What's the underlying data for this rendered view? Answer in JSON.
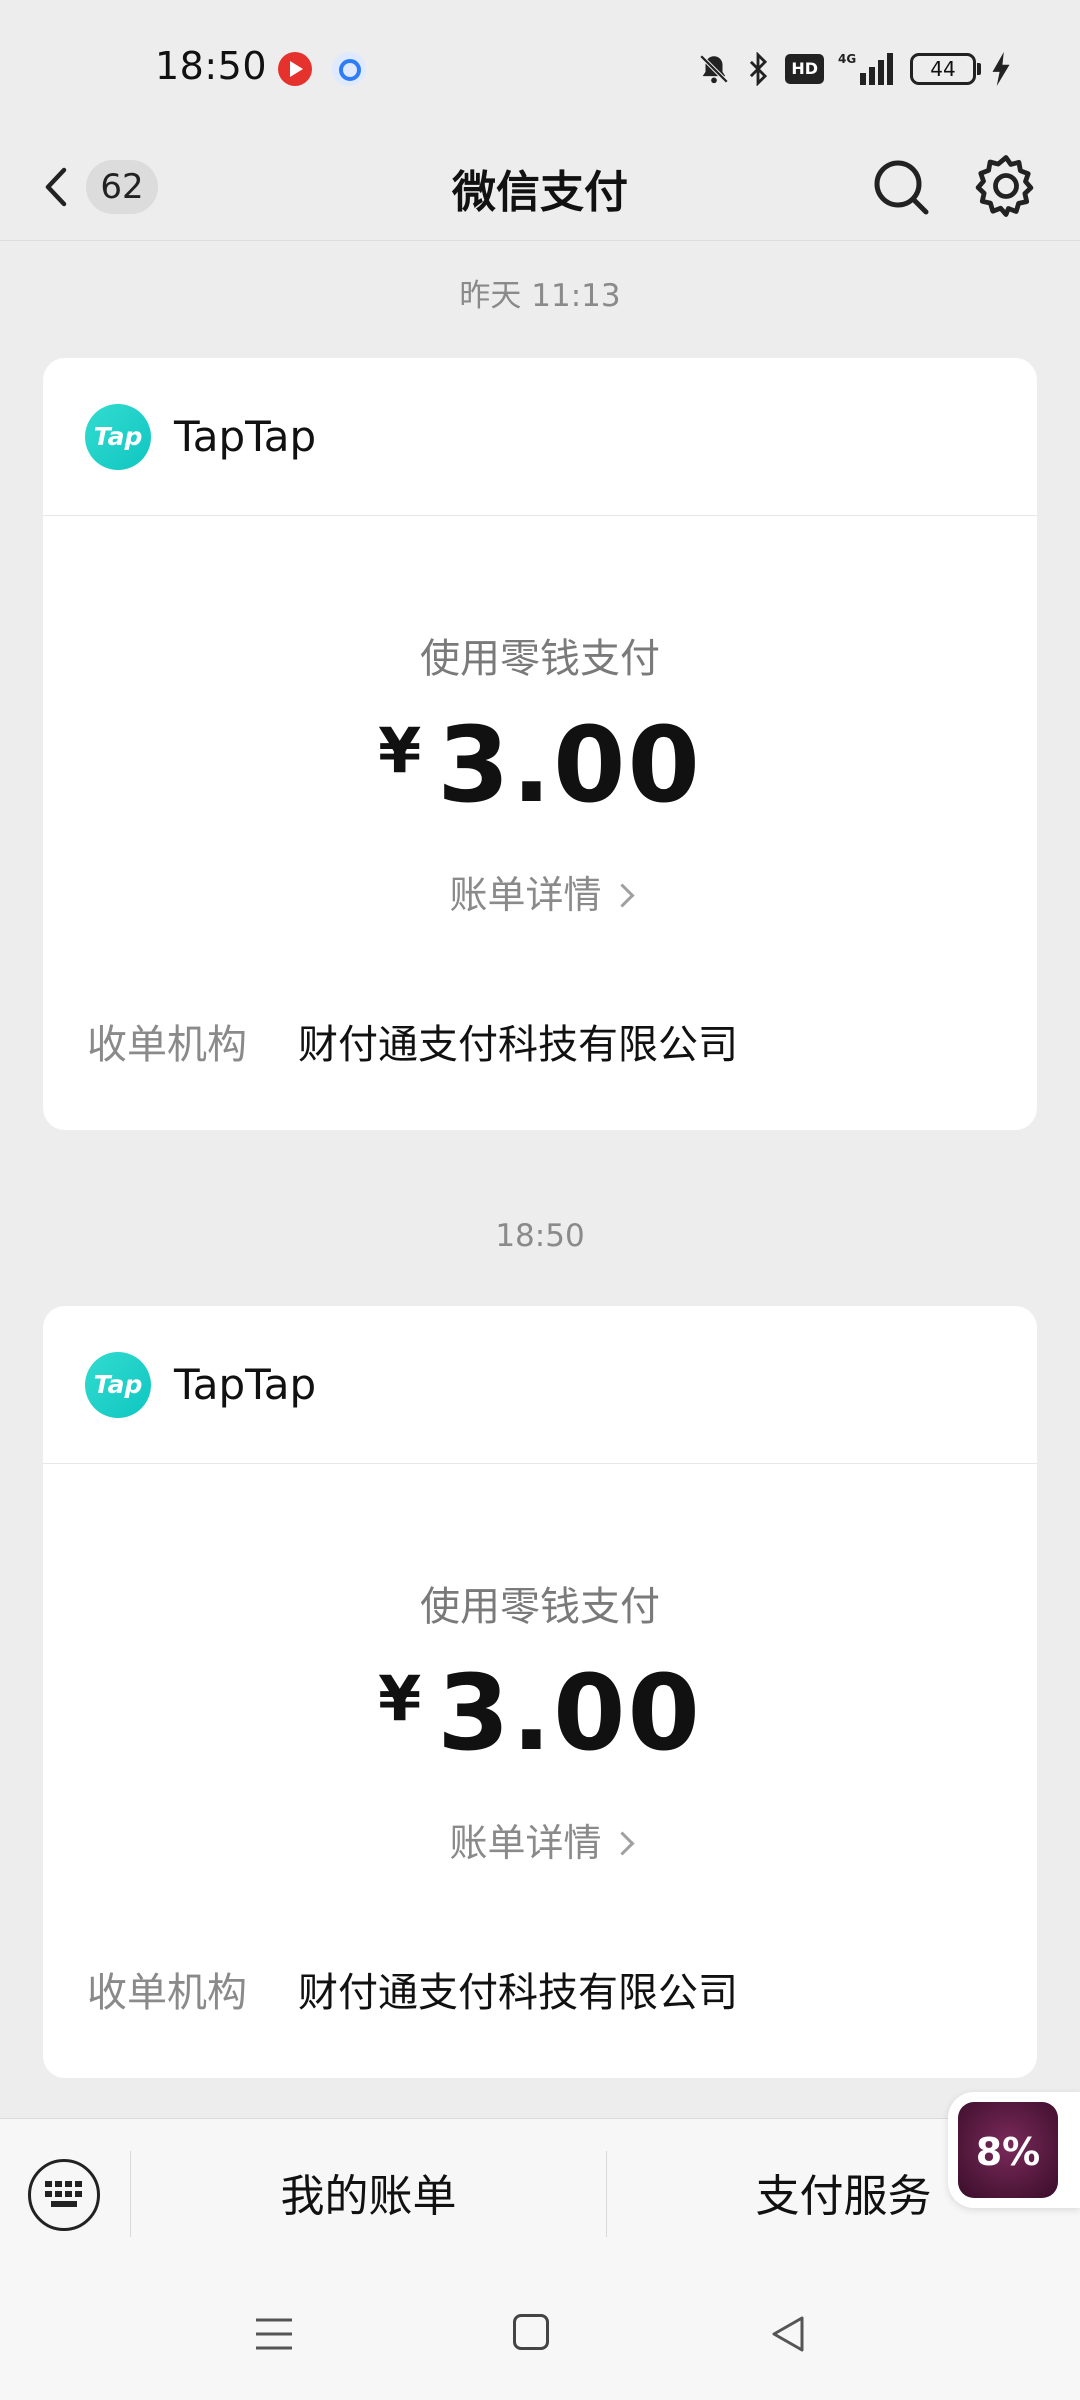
{
  "status_bar": {
    "time": "18:50",
    "battery": "44",
    "icons": [
      "bell-off-icon",
      "bluetooth-icon",
      "hd-icon",
      "signal-4g-icon",
      "battery-icon",
      "charging-icon"
    ]
  },
  "header": {
    "back_badge": "62",
    "title": "微信支付",
    "icons": [
      "back-icon",
      "search-icon",
      "gear-icon"
    ]
  },
  "messages": [
    {
      "timestamp": "昨天 11:13",
      "merchant": "TapTap",
      "logo_text": "Tap",
      "pay_method": "使用零钱支付",
      "currency": "¥",
      "amount": "3.00",
      "detail_link": "账单详情",
      "institution_label": "收单机构",
      "institution_value": "财付通支付科技有限公司"
    },
    {
      "timestamp": "18:50",
      "merchant": "TapTap",
      "logo_text": "Tap",
      "pay_method": "使用零钱支付",
      "currency": "¥",
      "amount": "3.00",
      "detail_link": "账单详情",
      "institution_label": "收单机构",
      "institution_value": "财付通支付科技有限公司"
    }
  ],
  "bottom_bar": {
    "my_bill": "我的账单",
    "pay_service": "支付服务"
  },
  "floating_widget": {
    "text": "8%"
  },
  "colors": {
    "background": "#ededed",
    "card": "#ffffff",
    "taptap_logo": "#18cfc6"
  }
}
